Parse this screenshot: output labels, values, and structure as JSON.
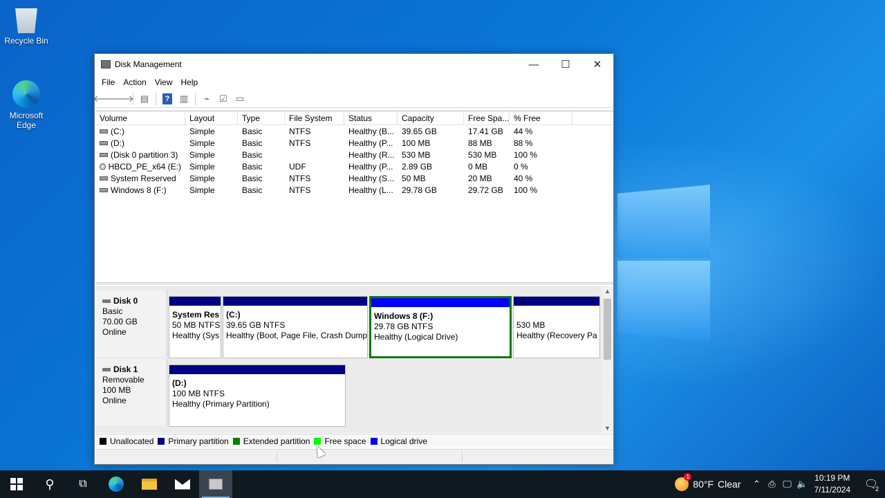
{
  "desktop": {
    "icons": [
      {
        "label": "Recycle Bin",
        "icon": "recycle-bin-icon"
      },
      {
        "label": "Microsoft Edge",
        "icon": "edge-icon"
      }
    ]
  },
  "window": {
    "title": "Disk Management",
    "controls": {
      "minimize": "—",
      "maximize": "☐",
      "close": "✕"
    },
    "menu": [
      "File",
      "Action",
      "View",
      "Help"
    ],
    "toolbar": {
      "back": "🡐",
      "forward": "🡒",
      "help": "?"
    }
  },
  "volumes": {
    "columns": [
      "Volume",
      "Layout",
      "Type",
      "File System",
      "Status",
      "Capacity",
      "Free Spa...",
      "% Free"
    ],
    "rows": [
      {
        "volume": "(C:)",
        "layout": "Simple",
        "type": "Basic",
        "fs": "NTFS",
        "status": "Healthy (B...",
        "capacity": "39.65 GB",
        "free": "17.41 GB",
        "pct": "44 %",
        "icon": "drive"
      },
      {
        "volume": "(D:)",
        "layout": "Simple",
        "type": "Basic",
        "fs": "NTFS",
        "status": "Healthy (P...",
        "capacity": "100 MB",
        "free": "88 MB",
        "pct": "88 %",
        "icon": "drive"
      },
      {
        "volume": "(Disk 0 partition 3)",
        "layout": "Simple",
        "type": "Basic",
        "fs": "",
        "status": "Healthy (R...",
        "capacity": "530 MB",
        "free": "530 MB",
        "pct": "100 %",
        "icon": "drive"
      },
      {
        "volume": "HBCD_PE_x64 (E:)",
        "layout": "Simple",
        "type": "Basic",
        "fs": "UDF",
        "status": "Healthy (P...",
        "capacity": "2.89 GB",
        "free": "0 MB",
        "pct": "0 %",
        "icon": "cd"
      },
      {
        "volume": "System Reserved",
        "layout": "Simple",
        "type": "Basic",
        "fs": "NTFS",
        "status": "Healthy (S...",
        "capacity": "50 MB",
        "free": "20 MB",
        "pct": "40 %",
        "icon": "drive"
      },
      {
        "volume": "Windows 8 (F:)",
        "layout": "Simple",
        "type": "Basic",
        "fs": "NTFS",
        "status": "Healthy (L...",
        "capacity": "29.78 GB",
        "free": "29.72 GB",
        "pct": "100 %",
        "icon": "drive"
      }
    ]
  },
  "disks": [
    {
      "name": "Disk 0",
      "kind": "Basic",
      "size": "70.00 GB",
      "state": "Online",
      "partitions": [
        {
          "title": "System Res",
          "size": "50 MB NTFS",
          "status": "Healthy (Sys",
          "type": "primary"
        },
        {
          "title": "(C:)",
          "size": "39.65 GB NTFS",
          "status": "Healthy (Boot, Page File, Crash Dump",
          "type": "primary"
        },
        {
          "title": "Windows 8  (F:)",
          "size": "29.78 GB NTFS",
          "status": "Healthy (Logical Drive)",
          "type": "logical"
        },
        {
          "title": "",
          "size": "530 MB",
          "status": "Healthy (Recovery Pa",
          "type": "primary"
        }
      ]
    },
    {
      "name": "Disk 1",
      "kind": "Removable",
      "size": "100 MB",
      "state": "Online",
      "partitions": [
        {
          "title": "(D:)",
          "size": "100 MB NTFS",
          "status": "Healthy (Primary Partition)",
          "type": "primary"
        }
      ]
    }
  ],
  "legend": [
    {
      "label": "Unallocated",
      "color": "#000000"
    },
    {
      "label": "Primary partition",
      "color": "#000080"
    },
    {
      "label": "Extended partition",
      "color": "#008000"
    },
    {
      "label": "Free space",
      "color": "#00ff00"
    },
    {
      "label": "Logical drive",
      "color": "#0000ff"
    }
  ],
  "taskbar": {
    "weather_temp": "80°F",
    "weather_text": "Clear",
    "weather_badge": "1",
    "time": "10:19 PM",
    "date": "7/11/2024",
    "notifications": "2"
  }
}
